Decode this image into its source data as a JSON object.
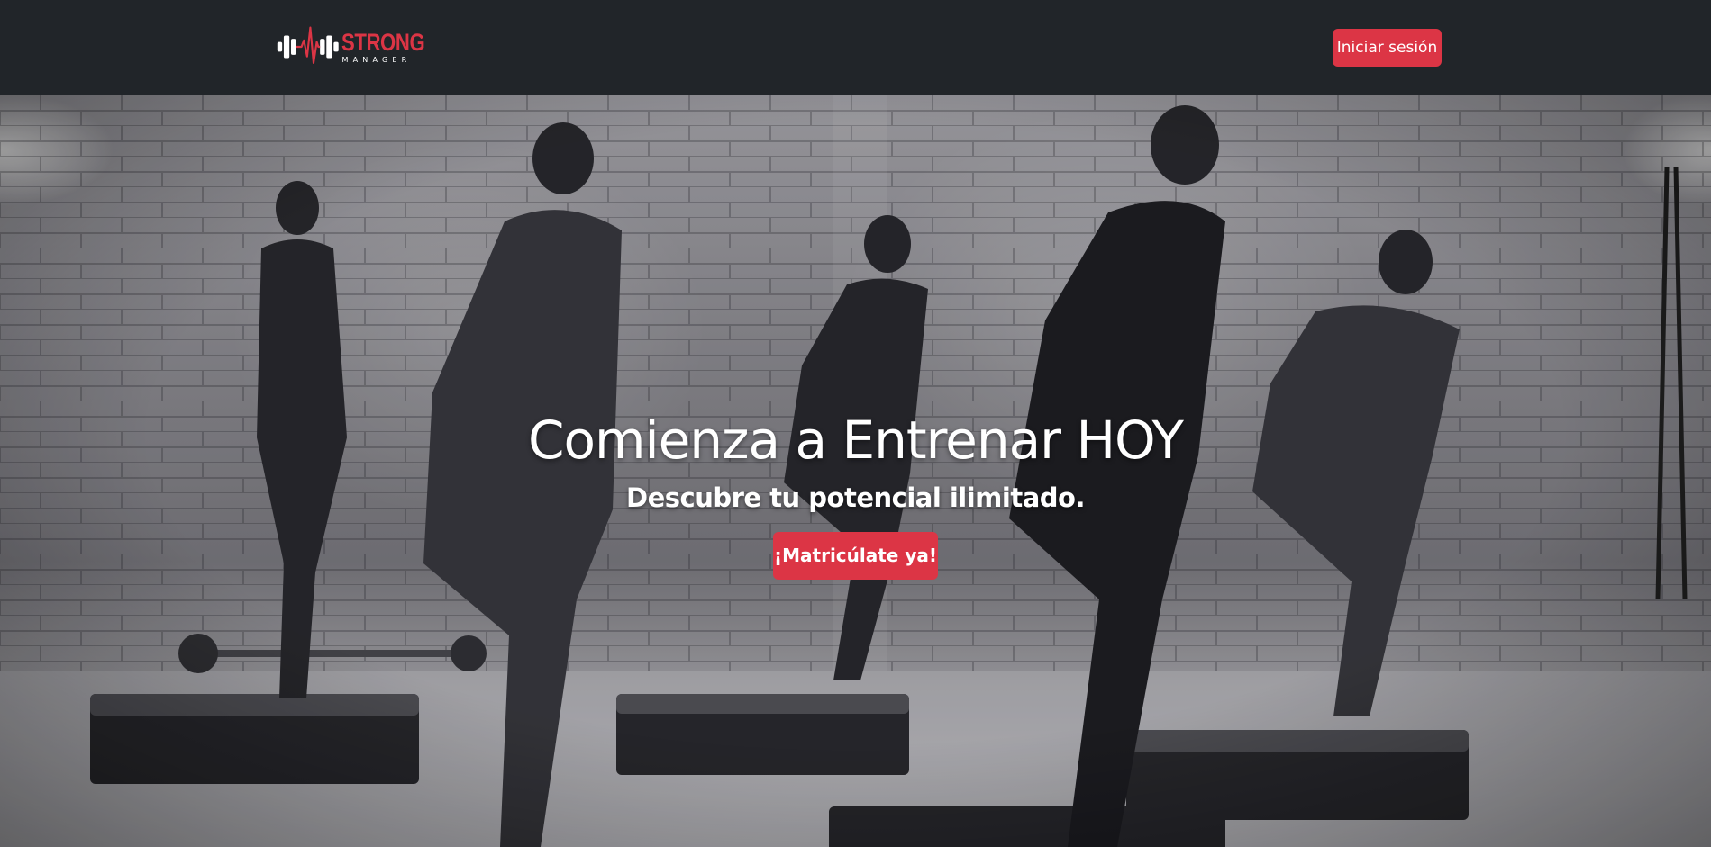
{
  "header": {
    "brand": {
      "name": "STRONG",
      "subtitle": "MANAGER",
      "logo_icon": "dumbbell-heartbeat-icon"
    },
    "login_label": "Iniciar sesión"
  },
  "hero": {
    "title": "Comienza a Entrenar HOY",
    "subtitle": "Descubre tu potencial ilimitado.",
    "cta_label": "¡Matricúlate ya!",
    "background_image": "black-and-white photo of five people doing step aerobics in a brick-walled gym"
  },
  "colors": {
    "navbar": "#212529",
    "accent": "#dc3545",
    "text_light": "#ffffff"
  }
}
